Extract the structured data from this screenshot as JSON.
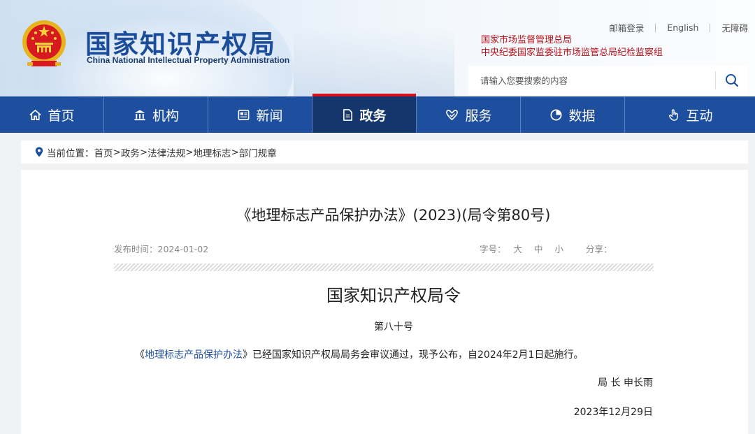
{
  "header": {
    "title": "国家知识产权局",
    "subtitle": "China National Intellectual Property Administration",
    "top_links": [
      "邮箱登录",
      "English",
      "无障碍"
    ],
    "org_links": [
      "国家市场监督管理总局",
      "中央纪委国家监委驻市场监管总局纪检监察组"
    ],
    "search_placeholder": "请输入您要搜索的内容"
  },
  "nav": {
    "items": [
      {
        "label": "首页",
        "icon": "home-icon"
      },
      {
        "label": "机构",
        "icon": "institution-icon"
      },
      {
        "label": "新闻",
        "icon": "news-icon"
      },
      {
        "label": "政务",
        "icon": "document-icon",
        "active": true
      },
      {
        "label": "服务",
        "icon": "service-icon"
      },
      {
        "label": "数据",
        "icon": "pie-chart-icon"
      },
      {
        "label": "互动",
        "icon": "hand-icon"
      }
    ]
  },
  "breadcrumb": {
    "prefix": "当前位置：",
    "items": [
      "首页",
      "政务",
      "法律法规",
      "地理标志",
      "部门规章"
    ],
    "separator": ">"
  },
  "article": {
    "title": "《地理标志产品保护办法》(2023)(局令第80号)",
    "publish_date": "发布时间：2024-01-02",
    "font_size_label": "字号：",
    "font_sizes": [
      "大",
      "中",
      "小"
    ],
    "share_label": "分享：",
    "doc_heading": "国家知识产权局令",
    "doc_number": "第八十号",
    "body_open": "《",
    "body_link": "地理标志产品保护办法",
    "body_rest": "》已经国家知识产权局局务会审议通过，现予公布，自2024年2月1日起施行。",
    "signature": "局 长  申长雨",
    "date": "2023年12月29日"
  },
  "colors": {
    "brand_blue": "#1e4f9e",
    "nav_active": "#15366d",
    "accent_red": "#d7141a",
    "org_red": "#b8121b"
  }
}
